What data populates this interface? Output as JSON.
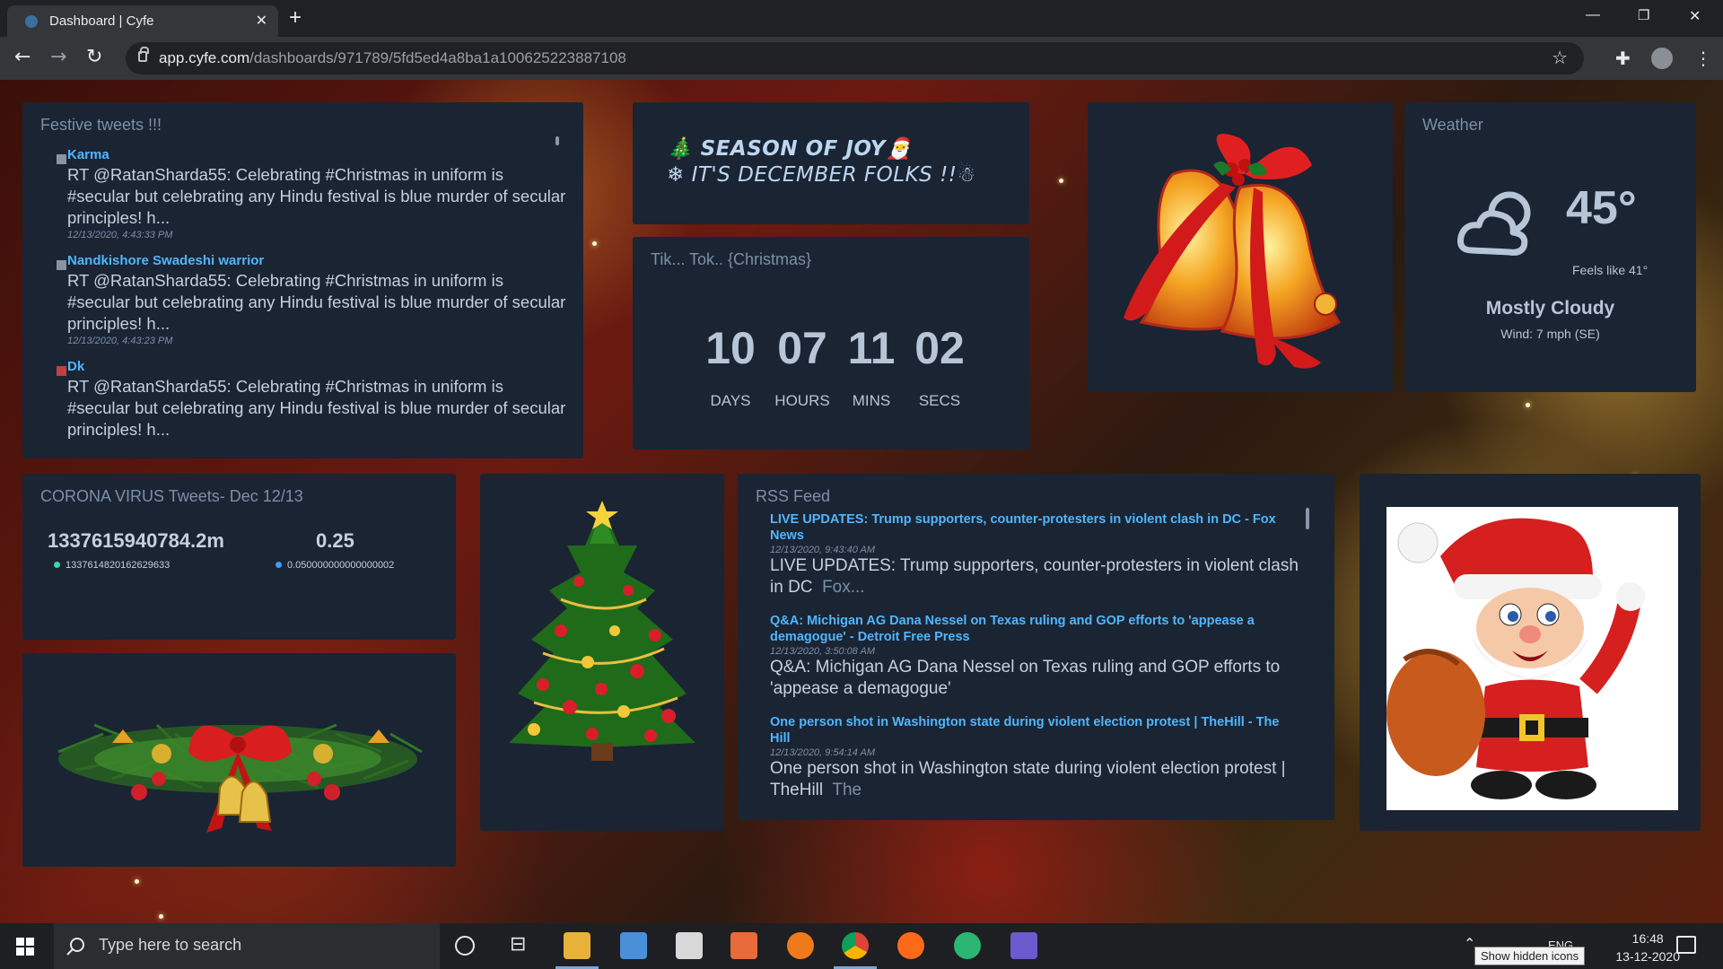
{
  "browser": {
    "tab_title": "Dashboard | Cyfe",
    "url_host": "app.cyfe.com",
    "url_path": "/dashboards/971789/5fd5ed4a8ba1a100625223887108"
  },
  "tweets": {
    "title": "Festive tweets !!!",
    "items": [
      {
        "name": "Karma",
        "text": "RT @RatanSharda55: Celebrating #Christmas in uniform is #secular but celebrating any Hindu festival is blue murder of secular principles! h...",
        "time": "12/13/2020, 4:43:33 PM"
      },
      {
        "name": "Nandkishore Swadeshi warrior",
        "text": "RT @RatanSharda55: Celebrating #Christmas in uniform is #secular but celebrating any Hindu festival is blue murder of secular principles! h...",
        "time": "12/13/2020, 4:43:23 PM"
      },
      {
        "name": "Dk",
        "text": "RT @RatanSharda55: Celebrating #Christmas in uniform is #secular but celebrating any Hindu festival is blue murder of secular principles! h...",
        "time": ""
      }
    ]
  },
  "joy": {
    "line1": "🎄 SEASON OF JOY🎅",
    "line2": "❄ IT'S DECEMBER FOLKS !!☃"
  },
  "countdown": {
    "title": "Tik... Tok.. {Christmas}",
    "days": "10",
    "hours": "07",
    "mins": "11",
    "secs": "02",
    "days_label": "DAYS",
    "hours_label": "HOURS",
    "mins_label": "MINS",
    "secs_label": "SECS"
  },
  "weather": {
    "title": "Weather",
    "temp": "45°",
    "feels": "Feels like 41°",
    "condition": "Mostly Cloudy",
    "wind": "Wind: 7 mph (SE)",
    "icon": "cloudy-icon"
  },
  "corona": {
    "title": "CORONA VIRUS Tweets- Dec 12/13",
    "kpi1_big": "1337615940784.2m",
    "kpi1_small": "1337614820162629633",
    "kpi1_color": "#3dd6a0",
    "kpi2_big": "0.25",
    "kpi2_small": "0.050000000000000002",
    "kpi2_color": "#3d9bff"
  },
  "rss": {
    "title": "RSS Feed",
    "items": [
      {
        "title": "LIVE UPDATES: Trump supporters, counter-protesters in violent clash in DC - Fox News",
        "time": "12/13/2020, 9:43:40 AM",
        "desc": "LIVE UPDATES: Trump supporters, counter-protesters in violent clash in DC",
        "src": "Fox..."
      },
      {
        "title": "Q&A: Michigan AG Dana Nessel on Texas ruling and GOP efforts to 'appease a demagogue' - Detroit Free Press",
        "time": "12/13/2020, 3:50:08 AM",
        "desc": "Q&A: Michigan AG Dana Nessel on Texas ruling and GOP efforts to 'appease a demagogue'",
        "src": ""
      },
      {
        "title": "One person shot in Washington state during violent election protest | TheHill - The Hill",
        "time": "12/13/2020, 9:54:14 AM",
        "desc": "One person shot in Washington state during violent election protest | TheHill",
        "src": "The"
      }
    ]
  },
  "taskbar": {
    "search_placeholder": "Type here to search",
    "lang": "ENG",
    "time": "16:48",
    "date": "13-12-2020",
    "tooltip": "Show hidden icons"
  }
}
